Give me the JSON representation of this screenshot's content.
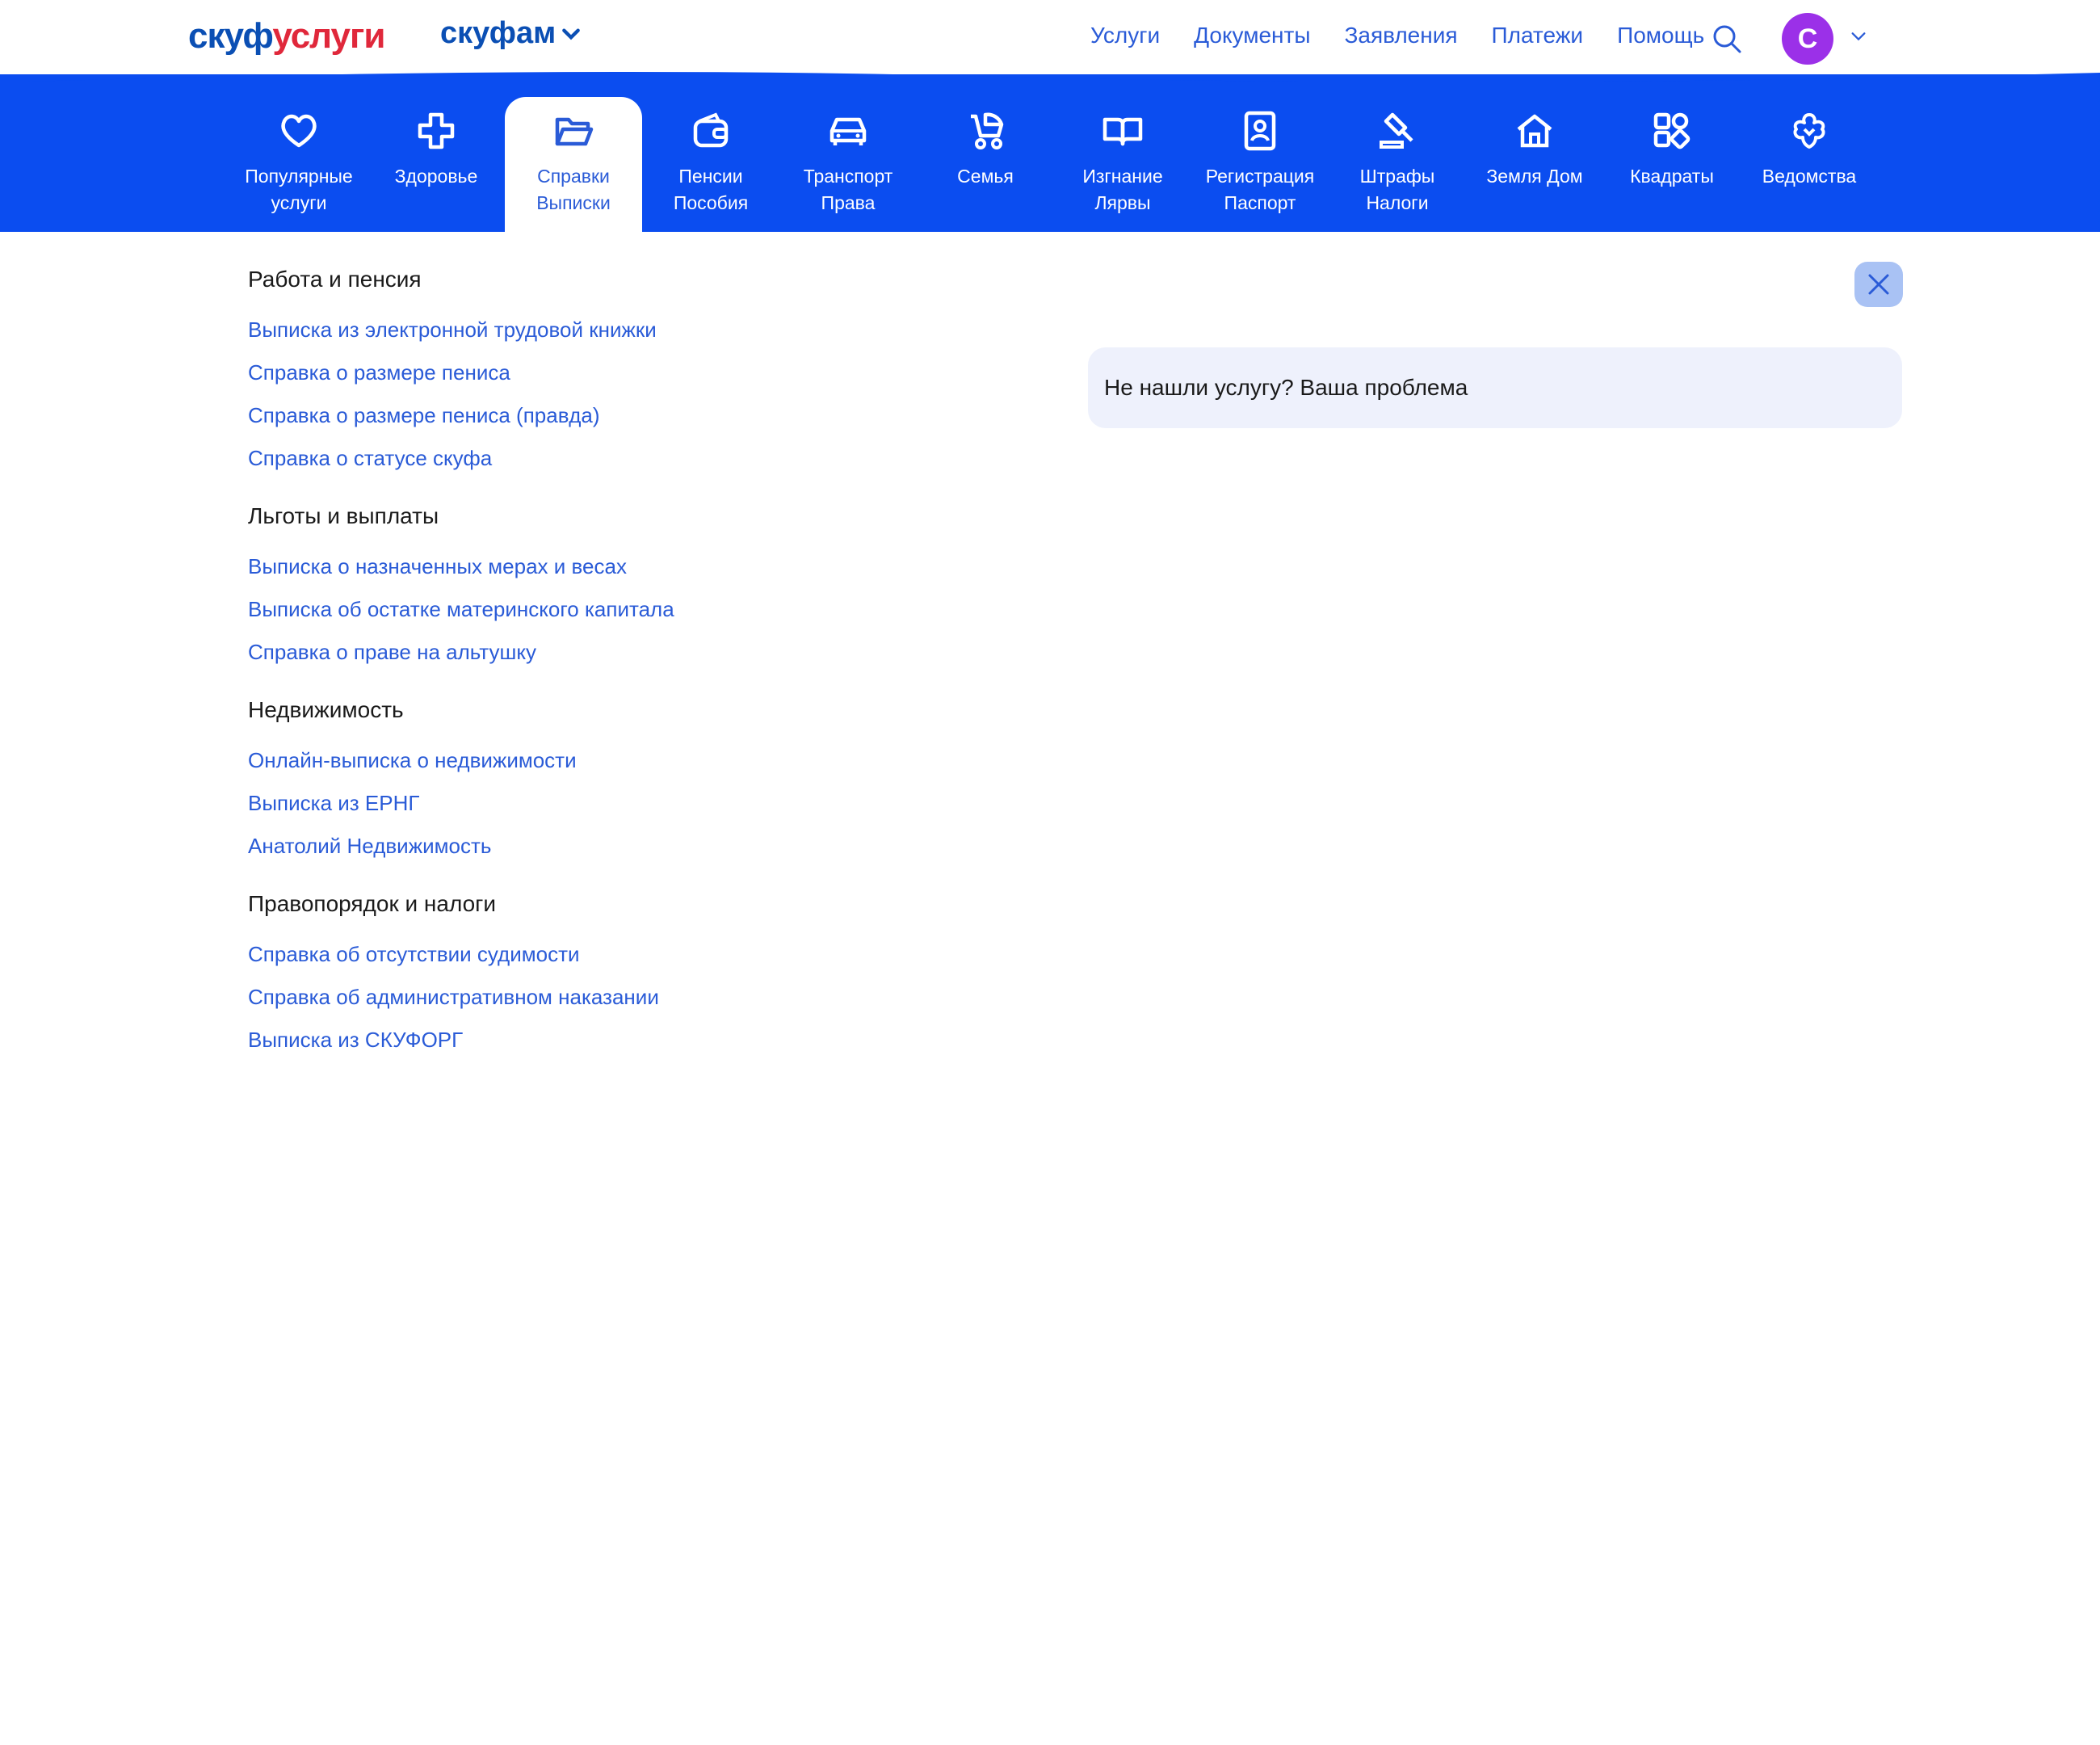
{
  "header": {
    "logo_part1": "скуф",
    "logo_part2": "услуги",
    "family_label": "скуфам",
    "nav": [
      "Услуги",
      "Документы",
      "Заявления",
      "Платежи",
      "Помощь"
    ],
    "avatar_letter": "С"
  },
  "colors": {
    "brand_blue": "#0b4df0",
    "link_blue": "#2a5bd7",
    "logo_red": "#e0283b",
    "avatar_purple": "#9b30e8"
  },
  "categories": [
    {
      "label": "Популярные\nуслуги",
      "icon": "heart-icon"
    },
    {
      "label": "Здоровье",
      "icon": "medical-cross-icon"
    },
    {
      "label": "Справки\nВыписки",
      "icon": "folder-icon",
      "active": true
    },
    {
      "label": "Пенсии\nПособия",
      "icon": "wallet-icon"
    },
    {
      "label": "Транспорт\nПрава",
      "icon": "car-icon"
    },
    {
      "label": "Семья",
      "icon": "stroller-icon"
    },
    {
      "label": "Изгнание\nЛярвы",
      "icon": "book-icon"
    },
    {
      "label": "Регистрация\nПаспорт",
      "icon": "passport-icon"
    },
    {
      "label": "Штрафы\nНалоги",
      "icon": "gavel-icon"
    },
    {
      "label": "Земля Дом",
      "icon": "house-icon"
    },
    {
      "label": "Квадраты",
      "icon": "squares-icon"
    },
    {
      "label": "Ведомства",
      "icon": "emblem-icon"
    }
  ],
  "groups": [
    {
      "title": "Работа и пенсия",
      "links": [
        "Выписка из электронной трудовой книжки",
        "Справка о размере пениса",
        "Справка о размере пениса (правда)",
        "Справка о статусе скуфа"
      ]
    },
    {
      "title": "Льготы и выплаты",
      "links": [
        "Выписка о назначенных мерах и весах",
        "Выписка об остатке материнского капитала",
        "Справка о праве на альтушку"
      ]
    },
    {
      "title": "Недвижимость",
      "links": [
        "Онлайн-выписка о недвижимости",
        "Выписка из ЕРНГ",
        "Анатолий Недвижимость"
      ]
    },
    {
      "title": "Правопорядок и налоги",
      "links": [
        "Справка об отсутствии судимости",
        "Справка об административном наказании",
        "Выписка из СКУФОРГ"
      ]
    }
  ],
  "notfound_text": "Не нашли услугу? Ваша проблема"
}
